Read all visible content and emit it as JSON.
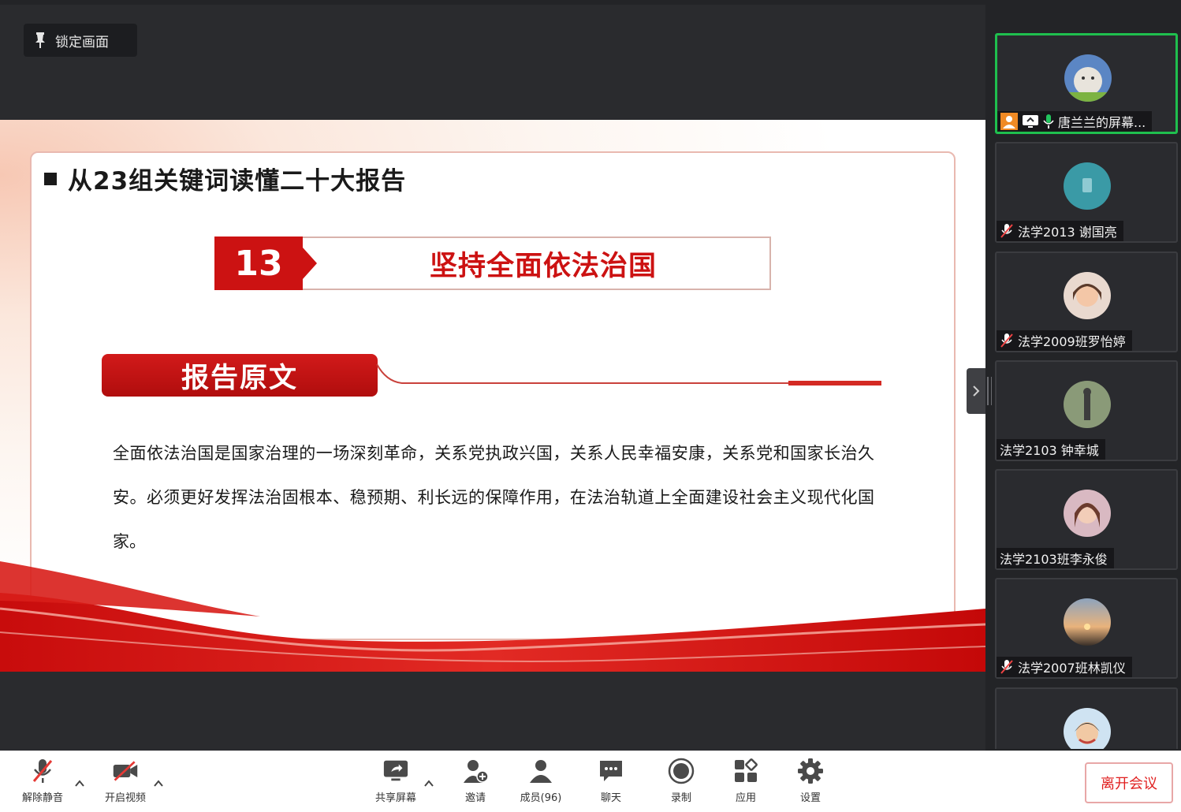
{
  "share": {
    "lock_label": "锁定画面"
  },
  "slide": {
    "title": "从23组关键词读懂二十大报告",
    "topic_number": "13",
    "topic_title": "坚持全面依法治国",
    "section_label": "报告原文",
    "body": "全面依法治国是国家治理的一场深刻革命，关系党执政兴国，关系人民幸福安康，关系党和国家长治久安。必须更好发挥法治固根本、稳预期、利长远的保障作用，在法治轨道上全面建设社会主义现代化国家。"
  },
  "participants": [
    {
      "name": "唐兰兰的屏幕...",
      "active": true,
      "icons": [
        "host-icon",
        "screen-share-icon",
        "mic-on-icon"
      ]
    },
    {
      "name": "法学2013 谢国亮",
      "active": false,
      "icons": [
        "mic-muted-icon"
      ]
    },
    {
      "name": "法学2009班罗怡婷",
      "active": false,
      "icons": [
        "mic-muted-icon"
      ]
    },
    {
      "name": "法学2103 钟幸城",
      "active": false,
      "icons": []
    },
    {
      "name": "法学2103班李永俊",
      "active": false,
      "icons": []
    },
    {
      "name": "法学2007班林凯仪",
      "active": false,
      "icons": [
        "mic-muted-icon"
      ]
    },
    {
      "name": "",
      "active": false,
      "icons": []
    }
  ],
  "toolbar": {
    "unmute_label": "解除静音",
    "video_label": "开启视频",
    "share_label": "共享屏幕",
    "invite_label": "邀请",
    "members_label": "成员(96)",
    "chat_label": "聊天",
    "record_label": "录制",
    "apps_label": "应用",
    "settings_label": "设置",
    "leave_label": "离开会议"
  },
  "colors": {
    "accent_red": "#cc1212",
    "active_speaker": "#1fbf4e",
    "leave_red": "#e02020"
  }
}
